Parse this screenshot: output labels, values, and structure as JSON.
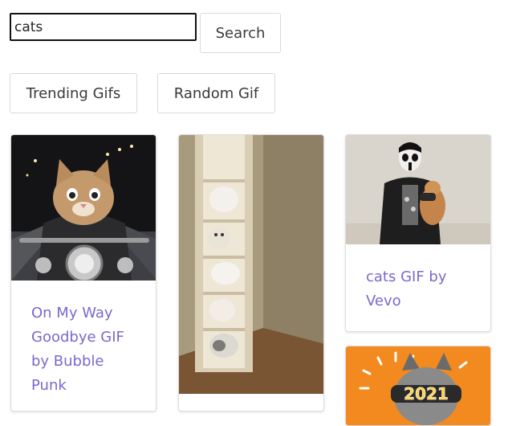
{
  "search": {
    "value": "cats",
    "button_label": "Search"
  },
  "actions": {
    "trending_label": "Trending Gifs",
    "random_label": "Random Gif"
  },
  "results": [
    {
      "title": "On My Way Goodbye GIF by Bubble Punk",
      "image_alt": "kitten riding motorcycle at night"
    },
    {
      "title": "",
      "image_alt": "kittens tumbling down hanging shelf"
    },
    {
      "title": "cats GIF by Vevo",
      "image_alt": "person in corpse paint holding cat"
    },
    {
      "title": "",
      "image_alt": "cat with 2021 glasses on orange background"
    }
  ],
  "colors": {
    "link": "#7b68cf",
    "border": "#d9d9d9",
    "focus_border": "#111111"
  }
}
